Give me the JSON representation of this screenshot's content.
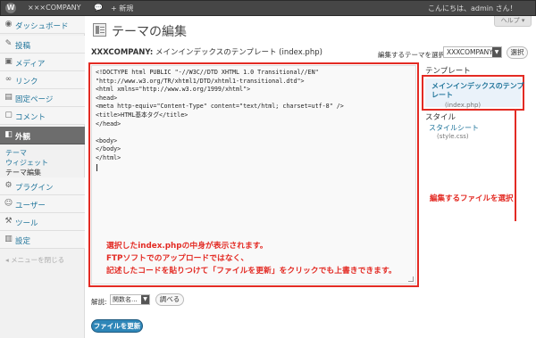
{
  "admin_bar": {
    "site_name": "×××COMPANY",
    "new_label": "+ 新規",
    "greeting": "こんにちは、admin さん！"
  },
  "help_tab": "ヘルプ ▾",
  "sidebar": {
    "dashboard": "ダッシュボード",
    "posts": "投稿",
    "media": "メディア",
    "links": "リンク",
    "pages": "固定ページ",
    "comments": "コメント",
    "appearance": "外観",
    "appearance_sub": [
      "テーマ",
      "ウィジェット",
      "テーマ編集"
    ],
    "plugins": "プラグイン",
    "users": "ユーザー",
    "tools": "ツール",
    "settings": "設定",
    "collapse": "メニューを閉じる"
  },
  "page_title": "テーマの編集",
  "file_heading": {
    "theme": "XXXCOMPANY:",
    "template": "メインインデックスのテンプレート",
    "file": "(index.php)"
  },
  "theme_select": {
    "label": "編集するテーマを選択:",
    "value": "XXXCOMPANY",
    "button": "選択"
  },
  "editor_code": "<!DOCTYPE html PUBLIC \"-//W3C//DTD XHTML 1.0 Transitional//EN\"\n\"http://www.w3.org/TR/xhtml1/DTD/xhtml1-transitional.dtd\">\n<html xmlns=\"http://www.w3.org/1999/xhtml\">\n<head>\n<meta http-equiv=\"Content-Type\" content=\"text/html; charset=utf-8\" />\n<title>HTML基本タグ</title>\n</head>\n\n<body>\n</body>\n</html>",
  "annotation_editor": "選択したindex.phpの中身が表示されます。\nFTPソフトでのアップロードではなく、\n記述したコードを貼りつけて「ファイルを更新」をクリックでも上書きできます。",
  "annotation_file": "編集するファイルを選択",
  "templates": {
    "heading": "テンプレート",
    "selected_name": "メインインデックスのテンプレート",
    "selected_file": "(index.php)"
  },
  "styles": {
    "heading": "スタイル",
    "link": "スタイルシート",
    "file": "(style.css)"
  },
  "docs": {
    "label": "解説:",
    "value": "関数名...",
    "button": "調べる"
  },
  "update_button": "ファイルを更新",
  "colors": {
    "annotation": "#e32b24",
    "link": "#21759b",
    "admin_bar": "#464646",
    "primary_button": "#2e86b8"
  }
}
